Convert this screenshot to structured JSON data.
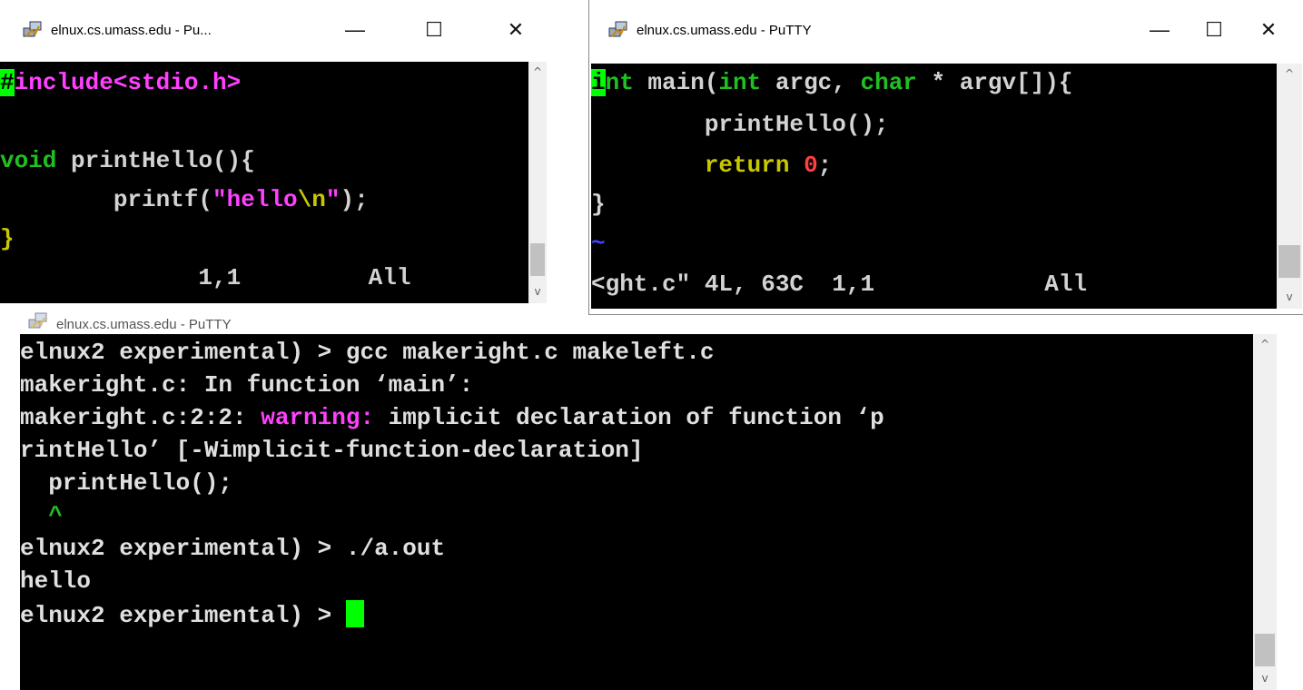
{
  "windows": {
    "left": {
      "title": "elnux.cs.umass.edu - Pu...",
      "minimize": "—",
      "maximize": "☐",
      "close": "✕",
      "lines": {
        "l1_cursor": "#",
        "l1_rest": "include<stdio.h>",
        "l3_kw": "void",
        "l3_rest": " printHello(){",
        "l4_pre": "        printf(",
        "l4_str": "\"hello",
        "l4_esc": "\\n",
        "l4_strend": "\"",
        "l4_post": ");",
        "l5": "}",
        "status": "              1,1         All"
      },
      "scroll_up": "^",
      "scroll_down": "v"
    },
    "right": {
      "title": "elnux.cs.umass.edu - PuTTY",
      "minimize": "—",
      "maximize": "☐",
      "close": "✕",
      "lines": {
        "l1_cursor": "i",
        "l1_kw1": "nt",
        "l1_mid": " main(",
        "l1_kw2": "int",
        "l1_mid2": " argc, ",
        "l1_kw3": "char",
        "l1_end": " * argv[]){",
        "l2": "        printHello();",
        "l3_pre": "        ",
        "l3_kw": "return",
        "l3_sp": " ",
        "l3_num": "0",
        "l3_end": ";",
        "l4": "}",
        "l5": "~",
        "status": "<ght.c\" 4L, 63C  1,1            All"
      },
      "scroll_up": "^",
      "scroll_down": "v"
    },
    "bottom": {
      "title": "elnux.cs.umass.edu - PuTTY",
      "lines": {
        "l1": "elnux2 experimental) > gcc makeright.c makeleft.c",
        "l2": "makeright.c: In function ‘main’:",
        "l3_pre": "makeright.c:2:2: ",
        "l3_warn": "warning:",
        "l3_post": " implicit declaration of function ‘p",
        "l4": "rintHello’ [-Wimplicit-function-declaration]",
        "l5": "  printHello();",
        "l6": "  ^",
        "l7": "elnux2 experimental) > ./a.out",
        "l8": "hello",
        "l9": "elnux2 experimental) > "
      },
      "scroll_up": "^",
      "scroll_down": "v"
    }
  },
  "colors": {
    "terminal_bg": "#000000",
    "cursor": "#00ff00",
    "preprocessor": "#ff40ff",
    "type_keyword": "#20c020",
    "statement_keyword": "#c8c800",
    "tilde": "#4040ff",
    "warning": "#ff40ff"
  },
  "icons": {
    "putty": "putty-icon"
  }
}
